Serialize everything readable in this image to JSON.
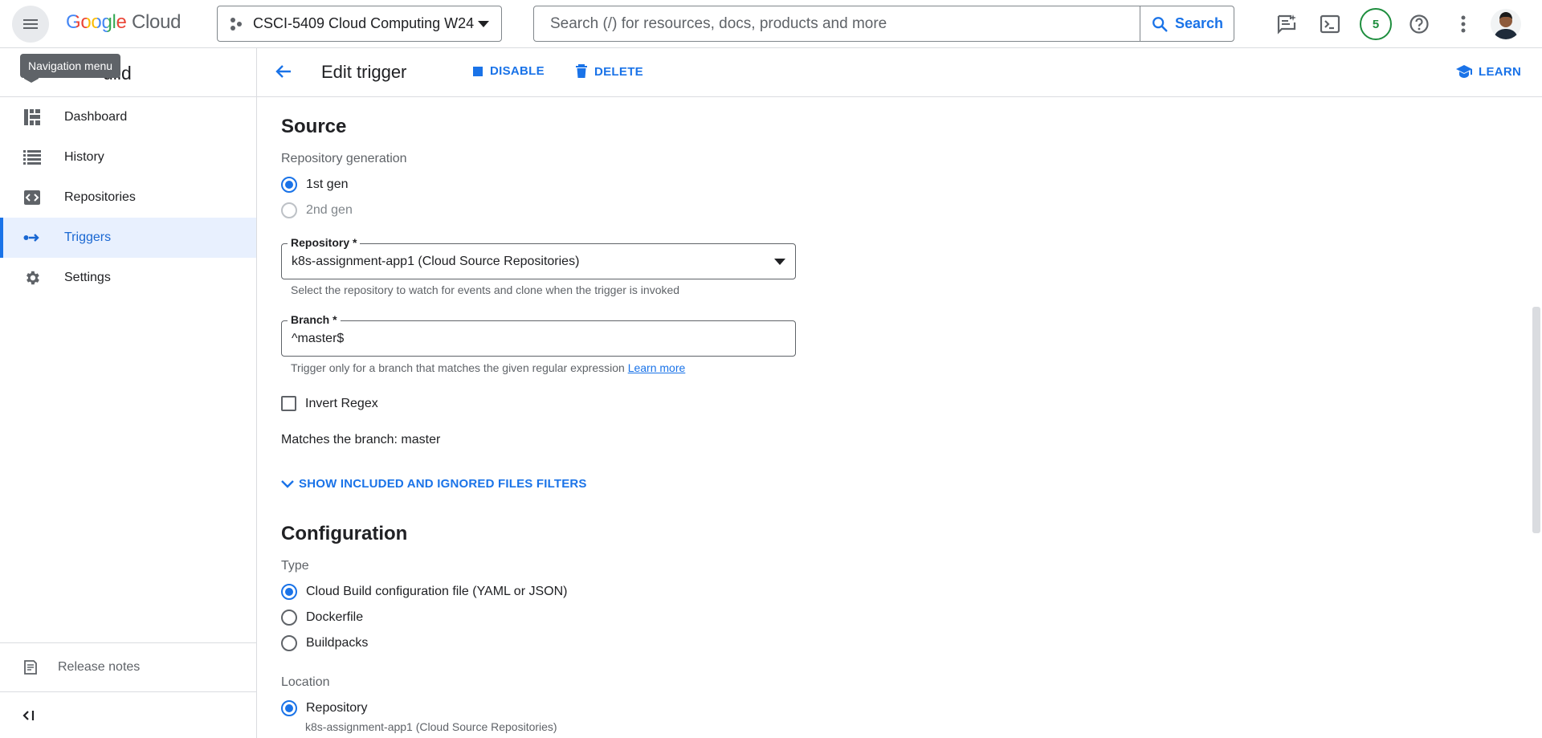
{
  "topbar": {
    "logo_google": "Google",
    "logo_cloud": "Cloud",
    "project": "CSCI-5409 Cloud Computing W24",
    "search_placeholder": "Search (/) for resources, docs, products and more",
    "search_button": "Search",
    "notification_count": "5"
  },
  "tooltip": "Navigation menu",
  "sidebar": {
    "product_name": "uild",
    "items": [
      {
        "label": "Dashboard",
        "icon": "dashboard-icon"
      },
      {
        "label": "History",
        "icon": "list-icon"
      },
      {
        "label": "Repositories",
        "icon": "code-icon"
      },
      {
        "label": "Triggers",
        "icon": "triggers-icon",
        "active": true
      },
      {
        "label": "Settings",
        "icon": "gear-icon"
      }
    ],
    "release_notes": "Release notes"
  },
  "header": {
    "title": "Edit trigger",
    "disable": "DISABLE",
    "delete": "DELETE",
    "learn": "LEARN"
  },
  "source": {
    "heading": "Source",
    "repo_gen_label": "Repository generation",
    "gen_options": [
      "1st gen",
      "2nd gen"
    ],
    "repository_label": "Repository *",
    "repository_value": "k8s-assignment-app1 (Cloud Source Repositories)",
    "repository_hint": "Select the repository to watch for events and clone when the trigger is invoked",
    "branch_label": "Branch *",
    "branch_value": "^master$",
    "branch_hint": "Trigger only for a branch that matches the given regular expression",
    "learn_more": "Learn more",
    "invert_regex": "Invert Regex",
    "matches": "Matches the branch: master",
    "show_filters": "SHOW INCLUDED AND IGNORED FILES FILTERS"
  },
  "configuration": {
    "heading": "Configuration",
    "type_label": "Type",
    "types": [
      "Cloud Build configuration file (YAML or JSON)",
      "Dockerfile",
      "Buildpacks"
    ],
    "location_label": "Location",
    "location_option": "Repository",
    "location_sub": "k8s-assignment-app1 (Cloud Source Repositories)"
  },
  "colors": {
    "accent": "#1a73e8",
    "active_bg": "#e8f0fe",
    "badge_green": "#1e8e3e"
  }
}
